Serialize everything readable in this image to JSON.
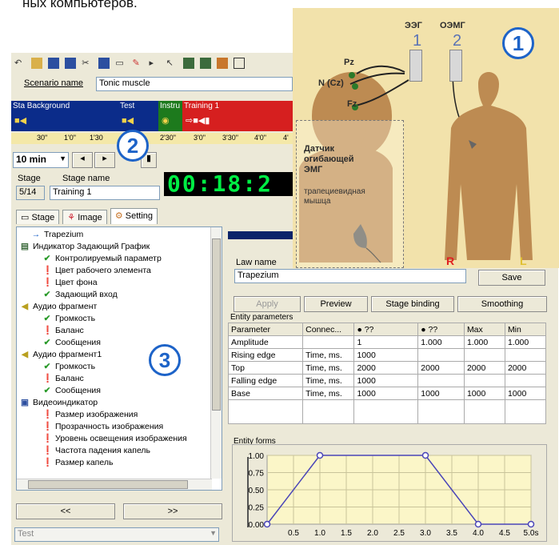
{
  "heading_fragment": "ных компьютеров.",
  "scenario": {
    "name_label": "Scenario name",
    "name_value": "Tonic muscle"
  },
  "strip": [
    {
      "label": "Sta Background",
      "color": "#0b2c8a"
    },
    {
      "label": "Test",
      "color": "#0b2c8a"
    },
    {
      "label": "Instru",
      "color": "#1d7a1d"
    },
    {
      "label": "Training 1",
      "color": "#d61f1f"
    }
  ],
  "ruler_ticks": [
    "30\"",
    "1'0\"",
    "1'30",
    "2'30\"",
    "3'0\"",
    "3'30\"",
    "4'0\"",
    "4'"
  ],
  "duration_select": "10 min",
  "stage": {
    "stage_label": "Stage",
    "stage_name_label": "Stage name",
    "stage_value": "5/14",
    "stage_name_value": "Training 1",
    "clock": "00:18:2"
  },
  "tabs": [
    "Stage",
    "Image",
    "Setting"
  ],
  "tree": [
    {
      "text": "Trapezium",
      "indent": 1,
      "icon": "arrow"
    },
    {
      "text": "Индикатор Задающий График",
      "indent": 0,
      "icon": "chart"
    },
    {
      "text": "Контролируемый параметр",
      "indent": 2,
      "icon": "check"
    },
    {
      "text": "Цвет рабочего элемента",
      "indent": 2,
      "icon": "excl"
    },
    {
      "text": "Цвет фона",
      "indent": 2,
      "icon": "excl"
    },
    {
      "text": "Задающий вход",
      "indent": 2,
      "icon": "check"
    },
    {
      "text": "Аудио фрагмент",
      "indent": 0,
      "icon": "audio"
    },
    {
      "text": "Громкость",
      "indent": 2,
      "icon": "check"
    },
    {
      "text": "Баланс",
      "indent": 2,
      "icon": "excl"
    },
    {
      "text": "Сообщения",
      "indent": 2,
      "icon": "check"
    },
    {
      "text": "Аудио фрагмент1",
      "indent": 0,
      "icon": "audio"
    },
    {
      "text": "Громкость",
      "indent": 2,
      "icon": "check"
    },
    {
      "text": "Баланс",
      "indent": 2,
      "icon": "excl"
    },
    {
      "text": "Сообщения",
      "indent": 2,
      "icon": "check"
    },
    {
      "text": "Видеоиндикатор",
      "indent": 0,
      "icon": "video"
    },
    {
      "text": "Размер изображения",
      "indent": 2,
      "icon": "excl"
    },
    {
      "text": "Прозрачность изображения",
      "indent": 2,
      "icon": "excl"
    },
    {
      "text": "Уровень освещения изображения",
      "indent": 2,
      "icon": "excl"
    },
    {
      "text": "Частота падения капель",
      "indent": 2,
      "icon": "excl"
    },
    {
      "text": "Размер капель",
      "indent": 2,
      "icon": "excl"
    }
  ],
  "nav": {
    "prev": "<<",
    "next": ">>"
  },
  "bottom_select": "Test",
  "law": {
    "label": "Law name",
    "value": "Trapezium",
    "save": "Save"
  },
  "buttons": [
    "Apply",
    "Preview",
    "Stage binding",
    "Smoothing"
  ],
  "entity_params": {
    "title": "Entity parameters",
    "headers": [
      "Parameter",
      "Connec...",
      "● ??",
      "● ??",
      "Max",
      "Min"
    ],
    "rows": [
      [
        "Amplitude",
        "",
        "1",
        "1.000",
        "1.000",
        "1.000"
      ],
      [
        "Rising edge",
        "Time, ms.",
        "1000",
        "",
        "",
        ""
      ],
      [
        "Top",
        "Time, ms.",
        "2000",
        "2000",
        "2000",
        "2000"
      ],
      [
        "Falling edge",
        "Time, ms.",
        "1000",
        "",
        "",
        ""
      ],
      [
        "Base",
        "Time, ms.",
        "1000",
        "1000",
        "1000",
        "1000"
      ]
    ]
  },
  "chart_data": {
    "type": "line",
    "title": "Entity forms",
    "x": [
      0,
      1.0,
      3.0,
      4.0,
      5.0
    ],
    "y": [
      0,
      1.0,
      1.0,
      0,
      0
    ],
    "x_ticks": [
      "0.5",
      "1.0",
      "1.5",
      "2.0",
      "2.5",
      "3.0",
      "3.5",
      "4.0",
      "4.5",
      "5.0s"
    ],
    "y_ticks": [
      "0.00",
      "0.25",
      "0.50",
      "0.75",
      "1.00"
    ],
    "xlim": [
      0,
      5.0
    ],
    "ylim": [
      0,
      1.0
    ]
  },
  "overlay": {
    "badge1": "1",
    "badge2": "2",
    "badge3": "3",
    "eeg_label": "ЭЭГ",
    "eeg_num": "1",
    "emg_label": "ОЭМГ",
    "emg_num": "2",
    "pz": "Pz",
    "ncz": "N (Cz)",
    "fz": "Fz",
    "sensor_title_1": "Датчик",
    "sensor_title_2": "огибающей",
    "sensor_title_3": "ЭМГ",
    "muscle_1": "трапециевидная",
    "muscle_2": "мышца",
    "r": "R",
    "l": "L"
  }
}
